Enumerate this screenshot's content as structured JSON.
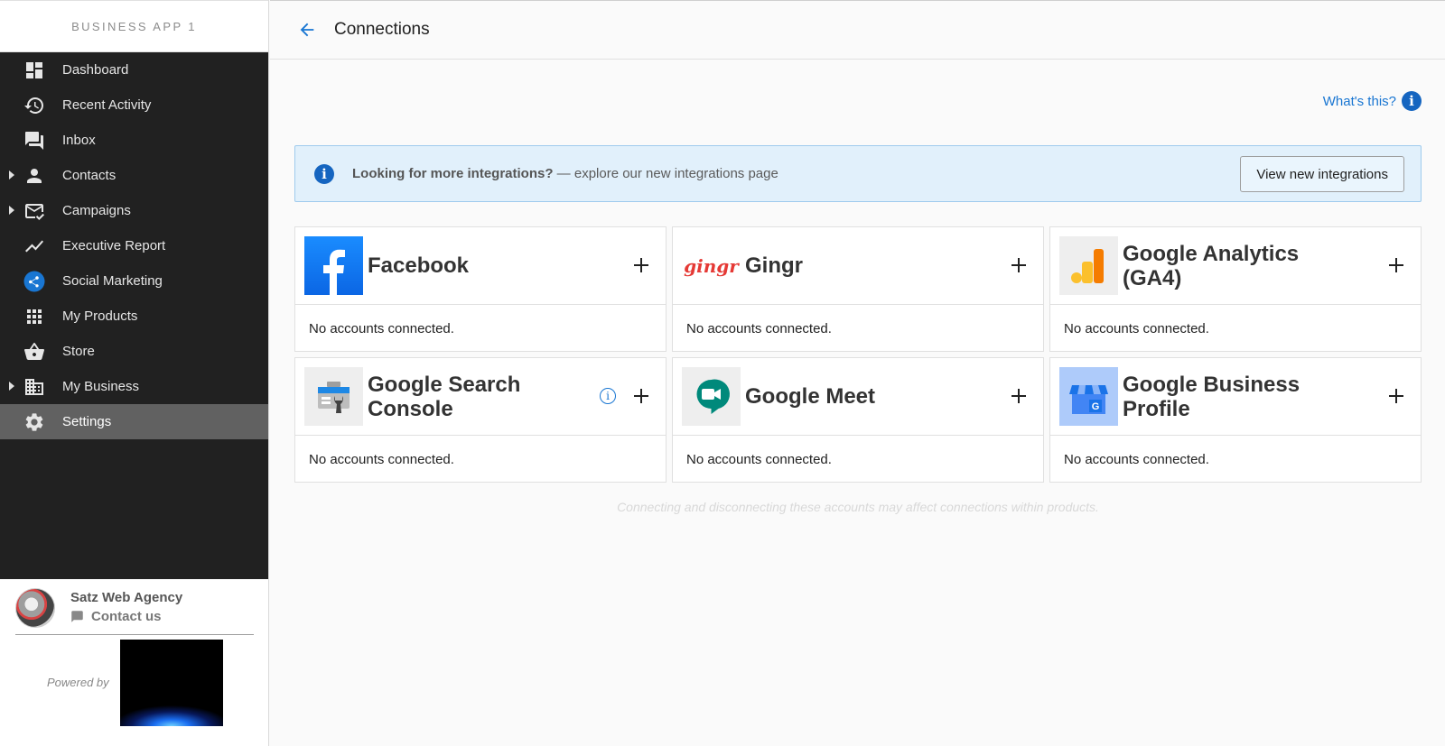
{
  "brand": "BUSINESS APP 1",
  "nav": {
    "items": [
      {
        "label": "Dashboard",
        "icon": "dashboard-icon",
        "expandable": false
      },
      {
        "label": "Recent Activity",
        "icon": "history-icon",
        "expandable": false
      },
      {
        "label": "Inbox",
        "icon": "chat-icon",
        "expandable": false
      },
      {
        "label": "Contacts",
        "icon": "person-icon",
        "expandable": true
      },
      {
        "label": "Campaigns",
        "icon": "mail-check-icon",
        "expandable": true
      },
      {
        "label": "Executive Report",
        "icon": "trend-icon",
        "expandable": false
      },
      {
        "label": "Social Marketing",
        "icon": "share-icon",
        "expandable": false
      },
      {
        "label": "My Products",
        "icon": "apps-grid-icon",
        "expandable": false
      },
      {
        "label": "Store",
        "icon": "basket-icon",
        "expandable": false
      },
      {
        "label": "My Business",
        "icon": "building-icon",
        "expandable": true
      },
      {
        "label": "Settings",
        "icon": "gear-icon",
        "expandable": false,
        "active": true
      }
    ]
  },
  "footer": {
    "agency_name": "Satz Web Agency",
    "contact_label": "Contact us",
    "powered_by": "Powered by"
  },
  "header": {
    "title": "Connections"
  },
  "whats_this": "What's this?",
  "banner": {
    "bold": "Looking for more integrations?",
    "text": " — explore our new integrations page",
    "button": "View new integrations"
  },
  "cards": [
    {
      "title": "Facebook",
      "status": "No accounts connected.",
      "logo": "facebook-logo"
    },
    {
      "title": "Gingr",
      "status": "No accounts connected.",
      "logo": "gingr-logo",
      "logo_text": "gingr"
    },
    {
      "title": "Google Analytics (GA4)",
      "status": "No accounts connected.",
      "logo": "google-analytics-logo"
    },
    {
      "title": "Google Search Console",
      "status": "No accounts connected.",
      "logo": "google-search-console-logo"
    },
    {
      "title": "Google Meet",
      "status": "No accounts connected.",
      "logo": "google-meet-logo"
    },
    {
      "title": "Google Business Profile",
      "status": "No accounts connected.",
      "logo": "google-business-profile-logo"
    }
  ],
  "note": "Connecting and disconnecting these accounts may affect connections within products.",
  "colors": {
    "sidebar_bg": "#212121",
    "sidebar_active": "#616161",
    "accent": "#1976d2",
    "banner_bg": "#e1f0fb"
  }
}
